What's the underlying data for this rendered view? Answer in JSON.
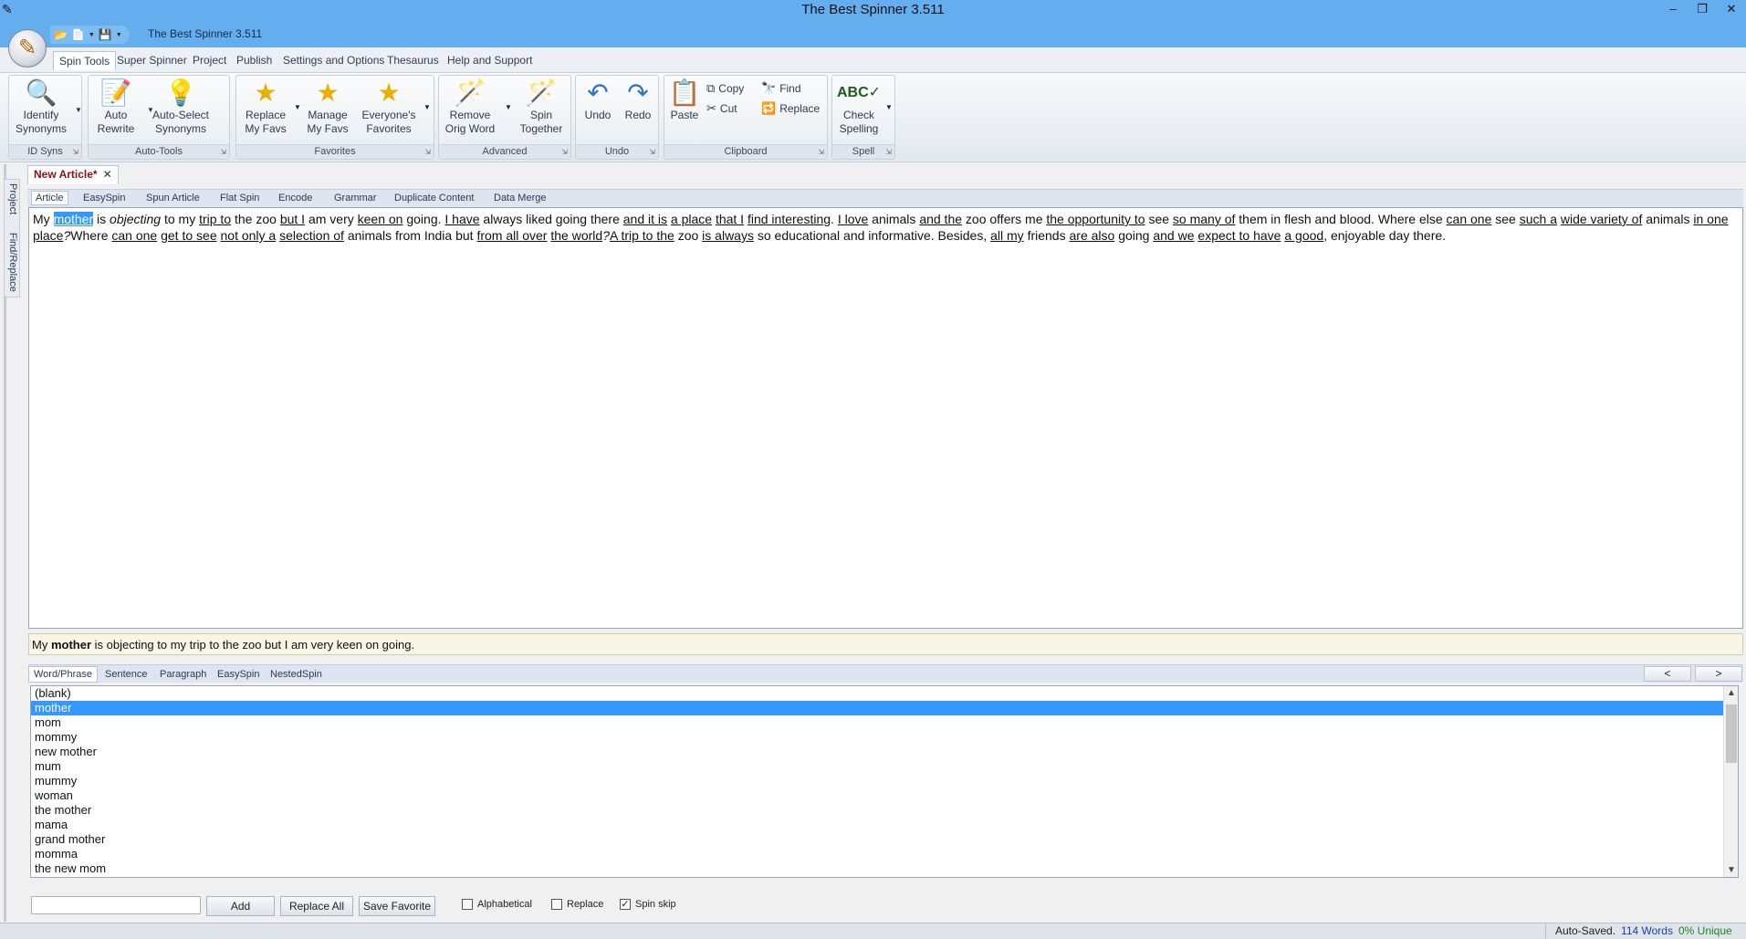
{
  "window": {
    "title": "The Best Spinner 3.511",
    "qat_title": "The Best Spinner 3.511",
    "minimize": "–",
    "restore": "❐",
    "close": "✕"
  },
  "ribbon_tabs": [
    "Spin Tools",
    "Super Spinner",
    "Project",
    "Publish",
    "Settings and Options",
    "Thesaurus",
    "Help and Support"
  ],
  "ribbon": {
    "groups": {
      "id_syns": "ID Syns",
      "auto_tools": "Auto-Tools",
      "favorites": "Favorites",
      "advanced": "Advanced",
      "undo": "Undo",
      "clipboard": "Clipboard",
      "spell": "Spell"
    },
    "buttons": {
      "identify_synonyms": [
        "Identify",
        "Synonyms"
      ],
      "auto_rewrite": [
        "Auto",
        "Rewrite"
      ],
      "auto_select_synonyms": [
        "Auto-Select",
        "Synonyms"
      ],
      "replace_my_favs": [
        "Replace",
        "My Favs"
      ],
      "manage_my_favs": [
        "Manage",
        "My Favs"
      ],
      "everyones_favorites": [
        "Everyone's",
        "Favorites"
      ],
      "remove_orig_word": [
        "Remove",
        "Orig Word"
      ],
      "spin_together": [
        "Spin",
        "Together"
      ],
      "undo": "Undo",
      "redo": "Redo",
      "paste": "Paste",
      "copy": "Copy",
      "cut": "Cut",
      "find": "Find",
      "replace": "Replace",
      "check_spelling": [
        "Check",
        "Spelling"
      ]
    }
  },
  "left_tabs": [
    "Project",
    "Find/Replace"
  ],
  "document_tab": "New Article*",
  "article_tabs": [
    "Article",
    "EasySpin",
    "Spun Article",
    "Flat Spin",
    "Encode",
    "Grammar",
    "Duplicate Content",
    "Data Merge"
  ],
  "article": {
    "segments": [
      {
        "t": "My ",
        "s": ""
      },
      {
        "t": "mother",
        "s": "sel"
      },
      {
        "t": " is ",
        "s": ""
      },
      {
        "t": "objecting",
        "s": "i"
      },
      {
        "t": " to my ",
        "s": ""
      },
      {
        "t": "trip to",
        "s": "u"
      },
      {
        "t": " the zoo ",
        "s": ""
      },
      {
        "t": "but I",
        "s": "u"
      },
      {
        "t": " am very ",
        "s": ""
      },
      {
        "t": "keen on",
        "s": "u"
      },
      {
        "t": " going. ",
        "s": ""
      },
      {
        "t": "I have",
        "s": "u"
      },
      {
        "t": " always liked going there ",
        "s": ""
      },
      {
        "t": "and it is",
        "s": "u"
      },
      {
        "t": " ",
        "s": ""
      },
      {
        "t": "a place",
        "s": "u"
      },
      {
        "t": " ",
        "s": ""
      },
      {
        "t": "that I",
        "s": "u"
      },
      {
        "t": " ",
        "s": ""
      },
      {
        "t": "find interesting",
        "s": "u"
      },
      {
        "t": ". ",
        "s": ""
      },
      {
        "t": "I love",
        "s": "u"
      },
      {
        "t": " animals ",
        "s": ""
      },
      {
        "t": "and the",
        "s": "u"
      },
      {
        "t": " zoo offers me ",
        "s": ""
      },
      {
        "t": "the opportunity to",
        "s": "u"
      },
      {
        "t": " see ",
        "s": ""
      },
      {
        "t": "so many of",
        "s": "u"
      },
      {
        "t": " them in flesh and blood. Where else ",
        "s": ""
      },
      {
        "t": "can one",
        "s": "u"
      },
      {
        "t": " see ",
        "s": ""
      },
      {
        "t": "such a",
        "s": "u"
      },
      {
        "t": " ",
        "s": ""
      },
      {
        "t": "wide variety of",
        "s": "u"
      },
      {
        "t": " animals ",
        "s": ""
      },
      {
        "t": "in one place",
        "s": "u"
      },
      {
        "t": "?",
        "s": "i"
      },
      {
        "t": "Where ",
        "s": ""
      },
      {
        "t": "can one",
        "s": "u"
      },
      {
        "t": " ",
        "s": ""
      },
      {
        "t": "get to see",
        "s": "u"
      },
      {
        "t": " ",
        "s": ""
      },
      {
        "t": "not only a",
        "s": "u"
      },
      {
        "t": " ",
        "s": ""
      },
      {
        "t": "selection of",
        "s": "u"
      },
      {
        "t": " animals from India but ",
        "s": ""
      },
      {
        "t": "from all over",
        "s": "u"
      },
      {
        "t": " ",
        "s": ""
      },
      {
        "t": "the world",
        "s": "u"
      },
      {
        "t": "?",
        "s": "i"
      },
      {
        "t": "A trip to the",
        "s": "u"
      },
      {
        "t": " zoo ",
        "s": ""
      },
      {
        "t": "is always",
        "s": "u"
      },
      {
        "t": " so educational and informative. Besides, ",
        "s": ""
      },
      {
        "t": "all my",
        "s": "u"
      },
      {
        "t": " friends ",
        "s": ""
      },
      {
        "t": "are also",
        "s": "u"
      },
      {
        "t": " going ",
        "s": ""
      },
      {
        "t": "and we",
        "s": "u"
      },
      {
        "t": " ",
        "s": ""
      },
      {
        "t": "expect to have",
        "s": "u"
      },
      {
        "t": " ",
        "s": ""
      },
      {
        "t": "a good",
        "s": "u"
      },
      {
        "t": ", enjoyable day there.",
        "s": ""
      }
    ]
  },
  "preview": {
    "before": "My ",
    "bold": "mother",
    "after": " is objecting to my trip to the zoo but I am very keen on going."
  },
  "bottom_tabs": [
    "Word/Phrase",
    "Sentence",
    "Paragraph",
    "EasySpin",
    "NestedSpin"
  ],
  "nav": {
    "prev": "<",
    "next": ">"
  },
  "synonyms": {
    "selected_index": 1,
    "items": [
      "(blank)",
      "mother",
      "mom",
      "mommy",
      "new mother",
      "mum",
      "mummy",
      "woman",
      "the mother",
      "mama",
      "grand mother",
      "momma",
      "the new mom"
    ]
  },
  "controls": {
    "input_value": "",
    "add": "Add",
    "replace_all": "Replace All",
    "save_favorite": "Save Favorite",
    "alphabetical": {
      "label": "Alphabetical",
      "checked": false
    },
    "replace": {
      "label": "Replace",
      "checked": false
    },
    "spin_skip": {
      "label": "Spin skip",
      "checked": true
    }
  },
  "status": {
    "saved": "Auto-Saved.",
    "words": "114 Words",
    "unique": "0% Unique"
  },
  "colors": {
    "titlebar": "#64aef0",
    "selection": "#3399ff",
    "doc_tab_text": "#8b1010",
    "words_text": "#1b3fa6",
    "unique_text": "#1c8a1c"
  }
}
